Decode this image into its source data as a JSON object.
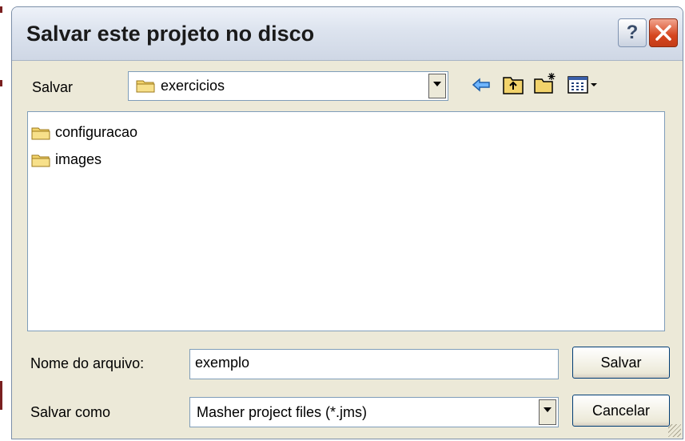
{
  "window": {
    "title": "Salvar este projeto no disco",
    "help_glyph": "?"
  },
  "save_in": {
    "label": "Salvar",
    "current_folder": "exercicios"
  },
  "toolbar": {
    "icons": [
      "back-arrow-icon",
      "up-one-level-icon",
      "create-new-folder-icon",
      "view-menu-icon"
    ]
  },
  "files": [
    {
      "name": "configuracao",
      "type": "folder"
    },
    {
      "name": "images",
      "type": "folder"
    }
  ],
  "filename": {
    "label": "Nome do arquivo:",
    "value": "exemplo"
  },
  "filetype": {
    "label": "Salvar como",
    "selected": "Masher project files (*.jms)"
  },
  "buttons": {
    "save": "Salvar",
    "cancel": "Cancelar"
  },
  "colors": {
    "dialog_bg": "#ece9d8",
    "close_red": "#d6461f",
    "folder_yellow": "#f2d36b"
  }
}
